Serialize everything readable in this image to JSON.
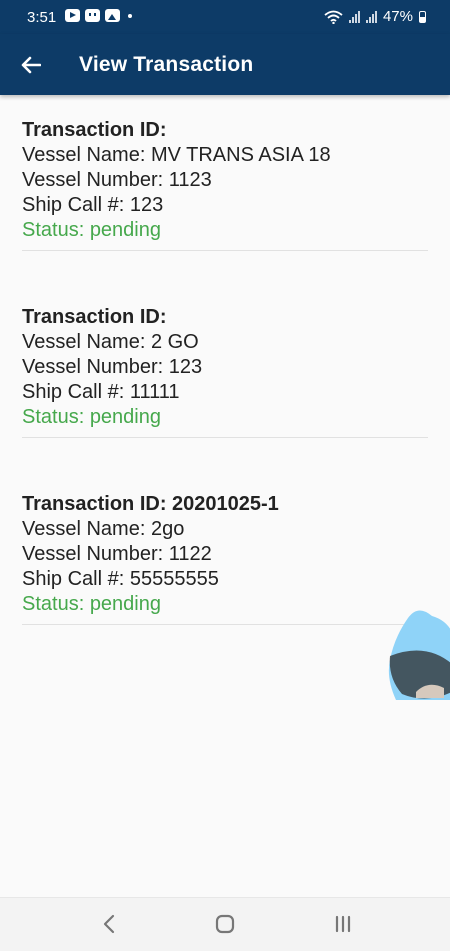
{
  "status_bar": {
    "time": "3:51",
    "battery": "47%",
    "icons": [
      "youtube-icon",
      "app-notification-icon",
      "gallery-icon",
      "dot-icon",
      "wifi-icon",
      "signal-icon",
      "battery-icon"
    ]
  },
  "app_bar": {
    "title": "View Transaction",
    "back_icon": "arrow-left-icon"
  },
  "transactions": [
    {
      "transaction_id": "Transaction ID:",
      "vessel_name": "Vessel Name: MV TRANS ASIA 18",
      "vessel_number": "Vessel Number: 1123",
      "ship_call": "Ship Call #: 123",
      "status": "Status: pending"
    },
    {
      "transaction_id": "Transaction ID:",
      "vessel_name": "Vessel Name: 2 GO",
      "vessel_number": "Vessel Number: 123",
      "ship_call": "Ship Call #: 11111",
      "status": "Status: pending"
    },
    {
      "transaction_id": "Transaction ID: 20201025-1",
      "vessel_name": "Vessel Name: 2go",
      "vessel_number": "Vessel Number: 1122",
      "ship_call": "Ship Call #: 55555555",
      "status": "Status: pending"
    }
  ],
  "colors": {
    "primary": "#0d3b67",
    "status_pending": "#46a84c",
    "background": "#fafafa",
    "bubble": "#8fd3f8"
  },
  "nav_bar": {
    "icons": [
      "back-icon",
      "home-icon",
      "recents-icon"
    ]
  }
}
